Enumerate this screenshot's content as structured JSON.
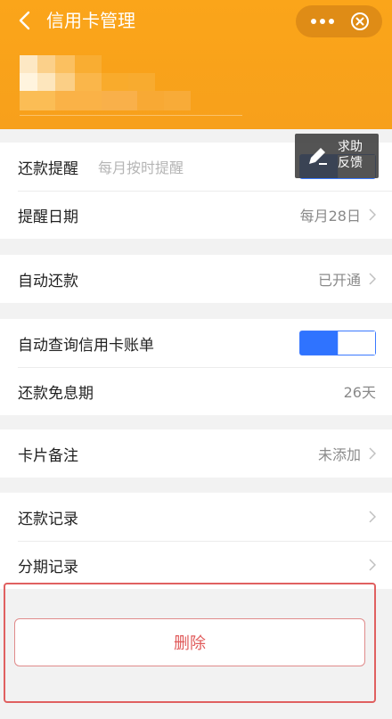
{
  "header": {
    "title": "信用卡管理",
    "accent": "#FAA31B"
  },
  "help": {
    "line1": "求助",
    "line2": "反馈"
  },
  "sections": {
    "reminder": {
      "repay_label": "还款提醒",
      "repay_hint": "每月按时提醒",
      "repay_toggle": "on",
      "date_label": "提醒日期",
      "date_value": "每月28日"
    },
    "auto": {
      "label": "自动还款",
      "value": "已开通"
    },
    "query": {
      "label": "自动查询信用卡账单",
      "toggle": "on",
      "interest_label": "还款免息期",
      "interest_value": "26天"
    },
    "note": {
      "label": "卡片备注",
      "value": "未添加"
    },
    "records": {
      "repay_label": "还款记录",
      "install_label": "分期记录"
    }
  },
  "actions": {
    "delete_label": "删除",
    "delete_color": "#E05A5A",
    "toggle_color": "#2F73FF"
  }
}
